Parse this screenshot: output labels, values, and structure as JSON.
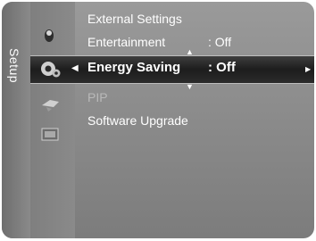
{
  "tab": {
    "label": "Setup"
  },
  "menu": {
    "items": [
      {
        "label": "External Settings",
        "value": ""
      },
      {
        "label": "Entertainment",
        "value": ": Off"
      },
      {
        "label": "Energy Saving",
        "value": ": Off"
      },
      {
        "label": "PIP",
        "value": ""
      },
      {
        "label": "Software Upgrade",
        "value": ""
      }
    ]
  },
  "icons": [
    "picture-icon",
    "setup-gear-icon",
    "input-icon",
    "application-icon"
  ],
  "colors": {
    "panel": "#8c8c8c",
    "highlight": "#1d1d1d",
    "text": "#ffffff",
    "disabled_text": "#b9b9b9"
  }
}
